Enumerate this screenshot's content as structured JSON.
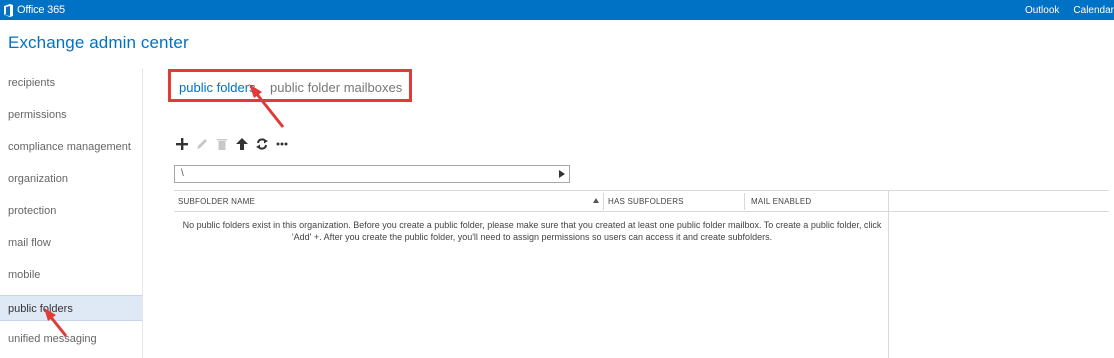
{
  "topbar": {
    "brand": "Office 365",
    "nav": [
      "Outlook",
      "Calendar"
    ]
  },
  "app": {
    "title": "Exchange admin center"
  },
  "sidebar": {
    "items": [
      {
        "label": "recipients",
        "selected": false
      },
      {
        "label": "permissions",
        "selected": false
      },
      {
        "label": "compliance management",
        "selected": false
      },
      {
        "label": "organization",
        "selected": false
      },
      {
        "label": "protection",
        "selected": false
      },
      {
        "label": "mail flow",
        "selected": false
      },
      {
        "label": "mobile",
        "selected": false
      },
      {
        "label": "public folders",
        "selected": true
      },
      {
        "label": "unified messaging",
        "selected": false
      }
    ]
  },
  "tabs": [
    {
      "label": "public folders",
      "active": true
    },
    {
      "label": "public folder mailboxes",
      "active": false
    }
  ],
  "toolbar": {
    "icons": [
      "add-icon",
      "edit-icon",
      "delete-icon",
      "move-up-icon",
      "refresh-icon",
      "more-icon"
    ]
  },
  "path": {
    "value": "\\"
  },
  "grid": {
    "columns": [
      "SUBFOLDER NAME",
      "HAS SUBFOLDERS",
      "MAIL ENABLED"
    ],
    "sorted_column": "SUBFOLDER NAME",
    "empty_message_line1": "No public folders exist in this organization. Before you create a public folder, please make sure that you created at least one public folder mailbox. To create a public folder, click",
    "empty_message_line2": "'Add' +. After you create the public folder, you'll need to assign permissions so users can access it and create subfolders."
  },
  "colors": {
    "brand": "#0072c6",
    "annotation": "#e23a36",
    "selected_nav": "#dfe9f5"
  }
}
